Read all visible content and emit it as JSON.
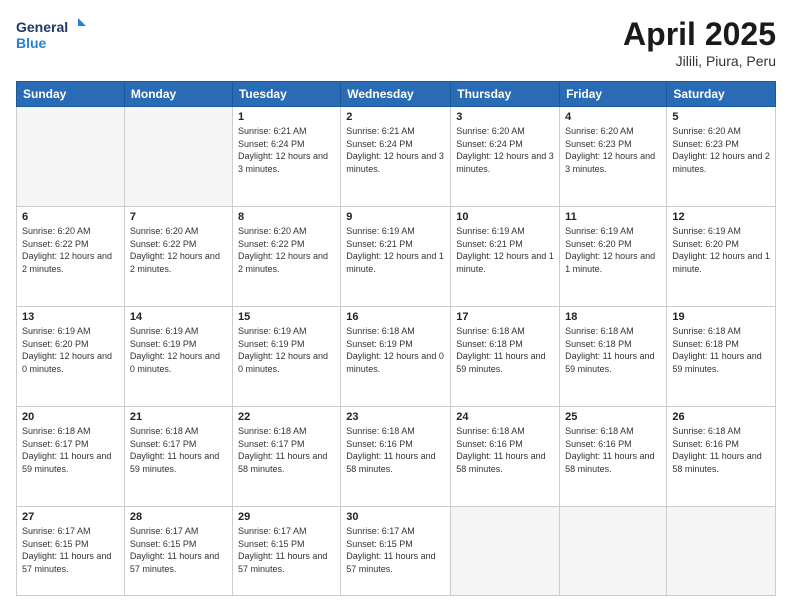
{
  "header": {
    "logo_line1": "General",
    "logo_line2": "Blue",
    "title": "April 2025",
    "subtitle": "Jilili, Piura, Peru"
  },
  "days_of_week": [
    "Sunday",
    "Monday",
    "Tuesday",
    "Wednesday",
    "Thursday",
    "Friday",
    "Saturday"
  ],
  "weeks": [
    [
      {
        "day": "",
        "info": ""
      },
      {
        "day": "",
        "info": ""
      },
      {
        "day": "1",
        "info": "Sunrise: 6:21 AM\nSunset: 6:24 PM\nDaylight: 12 hours and 3 minutes."
      },
      {
        "day": "2",
        "info": "Sunrise: 6:21 AM\nSunset: 6:24 PM\nDaylight: 12 hours and 3 minutes."
      },
      {
        "day": "3",
        "info": "Sunrise: 6:20 AM\nSunset: 6:24 PM\nDaylight: 12 hours and 3 minutes."
      },
      {
        "day": "4",
        "info": "Sunrise: 6:20 AM\nSunset: 6:23 PM\nDaylight: 12 hours and 3 minutes."
      },
      {
        "day": "5",
        "info": "Sunrise: 6:20 AM\nSunset: 6:23 PM\nDaylight: 12 hours and 2 minutes."
      }
    ],
    [
      {
        "day": "6",
        "info": "Sunrise: 6:20 AM\nSunset: 6:22 PM\nDaylight: 12 hours and 2 minutes."
      },
      {
        "day": "7",
        "info": "Sunrise: 6:20 AM\nSunset: 6:22 PM\nDaylight: 12 hours and 2 minutes."
      },
      {
        "day": "8",
        "info": "Sunrise: 6:20 AM\nSunset: 6:22 PM\nDaylight: 12 hours and 2 minutes."
      },
      {
        "day": "9",
        "info": "Sunrise: 6:19 AM\nSunset: 6:21 PM\nDaylight: 12 hours and 1 minute."
      },
      {
        "day": "10",
        "info": "Sunrise: 6:19 AM\nSunset: 6:21 PM\nDaylight: 12 hours and 1 minute."
      },
      {
        "day": "11",
        "info": "Sunrise: 6:19 AM\nSunset: 6:20 PM\nDaylight: 12 hours and 1 minute."
      },
      {
        "day": "12",
        "info": "Sunrise: 6:19 AM\nSunset: 6:20 PM\nDaylight: 12 hours and 1 minute."
      }
    ],
    [
      {
        "day": "13",
        "info": "Sunrise: 6:19 AM\nSunset: 6:20 PM\nDaylight: 12 hours and 0 minutes."
      },
      {
        "day": "14",
        "info": "Sunrise: 6:19 AM\nSunset: 6:19 PM\nDaylight: 12 hours and 0 minutes."
      },
      {
        "day": "15",
        "info": "Sunrise: 6:19 AM\nSunset: 6:19 PM\nDaylight: 12 hours and 0 minutes."
      },
      {
        "day": "16",
        "info": "Sunrise: 6:18 AM\nSunset: 6:19 PM\nDaylight: 12 hours and 0 minutes."
      },
      {
        "day": "17",
        "info": "Sunrise: 6:18 AM\nSunset: 6:18 PM\nDaylight: 11 hours and 59 minutes."
      },
      {
        "day": "18",
        "info": "Sunrise: 6:18 AM\nSunset: 6:18 PM\nDaylight: 11 hours and 59 minutes."
      },
      {
        "day": "19",
        "info": "Sunrise: 6:18 AM\nSunset: 6:18 PM\nDaylight: 11 hours and 59 minutes."
      }
    ],
    [
      {
        "day": "20",
        "info": "Sunrise: 6:18 AM\nSunset: 6:17 PM\nDaylight: 11 hours and 59 minutes."
      },
      {
        "day": "21",
        "info": "Sunrise: 6:18 AM\nSunset: 6:17 PM\nDaylight: 11 hours and 59 minutes."
      },
      {
        "day": "22",
        "info": "Sunrise: 6:18 AM\nSunset: 6:17 PM\nDaylight: 11 hours and 58 minutes."
      },
      {
        "day": "23",
        "info": "Sunrise: 6:18 AM\nSunset: 6:16 PM\nDaylight: 11 hours and 58 minutes."
      },
      {
        "day": "24",
        "info": "Sunrise: 6:18 AM\nSunset: 6:16 PM\nDaylight: 11 hours and 58 minutes."
      },
      {
        "day": "25",
        "info": "Sunrise: 6:18 AM\nSunset: 6:16 PM\nDaylight: 11 hours and 58 minutes."
      },
      {
        "day": "26",
        "info": "Sunrise: 6:18 AM\nSunset: 6:16 PM\nDaylight: 11 hours and 58 minutes."
      }
    ],
    [
      {
        "day": "27",
        "info": "Sunrise: 6:17 AM\nSunset: 6:15 PM\nDaylight: 11 hours and 57 minutes."
      },
      {
        "day": "28",
        "info": "Sunrise: 6:17 AM\nSunset: 6:15 PM\nDaylight: 11 hours and 57 minutes."
      },
      {
        "day": "29",
        "info": "Sunrise: 6:17 AM\nSunset: 6:15 PM\nDaylight: 11 hours and 57 minutes."
      },
      {
        "day": "30",
        "info": "Sunrise: 6:17 AM\nSunset: 6:15 PM\nDaylight: 11 hours and 57 minutes."
      },
      {
        "day": "",
        "info": ""
      },
      {
        "day": "",
        "info": ""
      },
      {
        "day": "",
        "info": ""
      }
    ]
  ]
}
